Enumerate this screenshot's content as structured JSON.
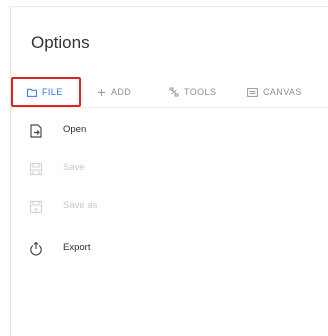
{
  "dialog": {
    "title": "Options"
  },
  "tabs": [
    {
      "label": "FILE",
      "icon": "folder-icon",
      "active": true
    },
    {
      "label": "ADD",
      "icon": "plus-icon",
      "active": false
    },
    {
      "label": "TOOLS",
      "icon": "tools-icon",
      "active": false
    },
    {
      "label": "CANVAS",
      "icon": "canvas-icon",
      "active": false
    }
  ],
  "menu": {
    "items": [
      {
        "label": "Open",
        "icon": "open-file-icon",
        "enabled": true
      },
      {
        "label": "Save",
        "icon": "save-icon",
        "enabled": false
      },
      {
        "label": "Save as",
        "icon": "save-as-icon",
        "enabled": false
      },
      {
        "label": "Export",
        "icon": "export-icon",
        "enabled": true
      }
    ]
  },
  "colors": {
    "accent": "#2f6fe0",
    "highlight_border": "#e02323",
    "text": "#2d2d2d",
    "muted": "#8f8f8f",
    "disabled": "#c9c9c9"
  }
}
